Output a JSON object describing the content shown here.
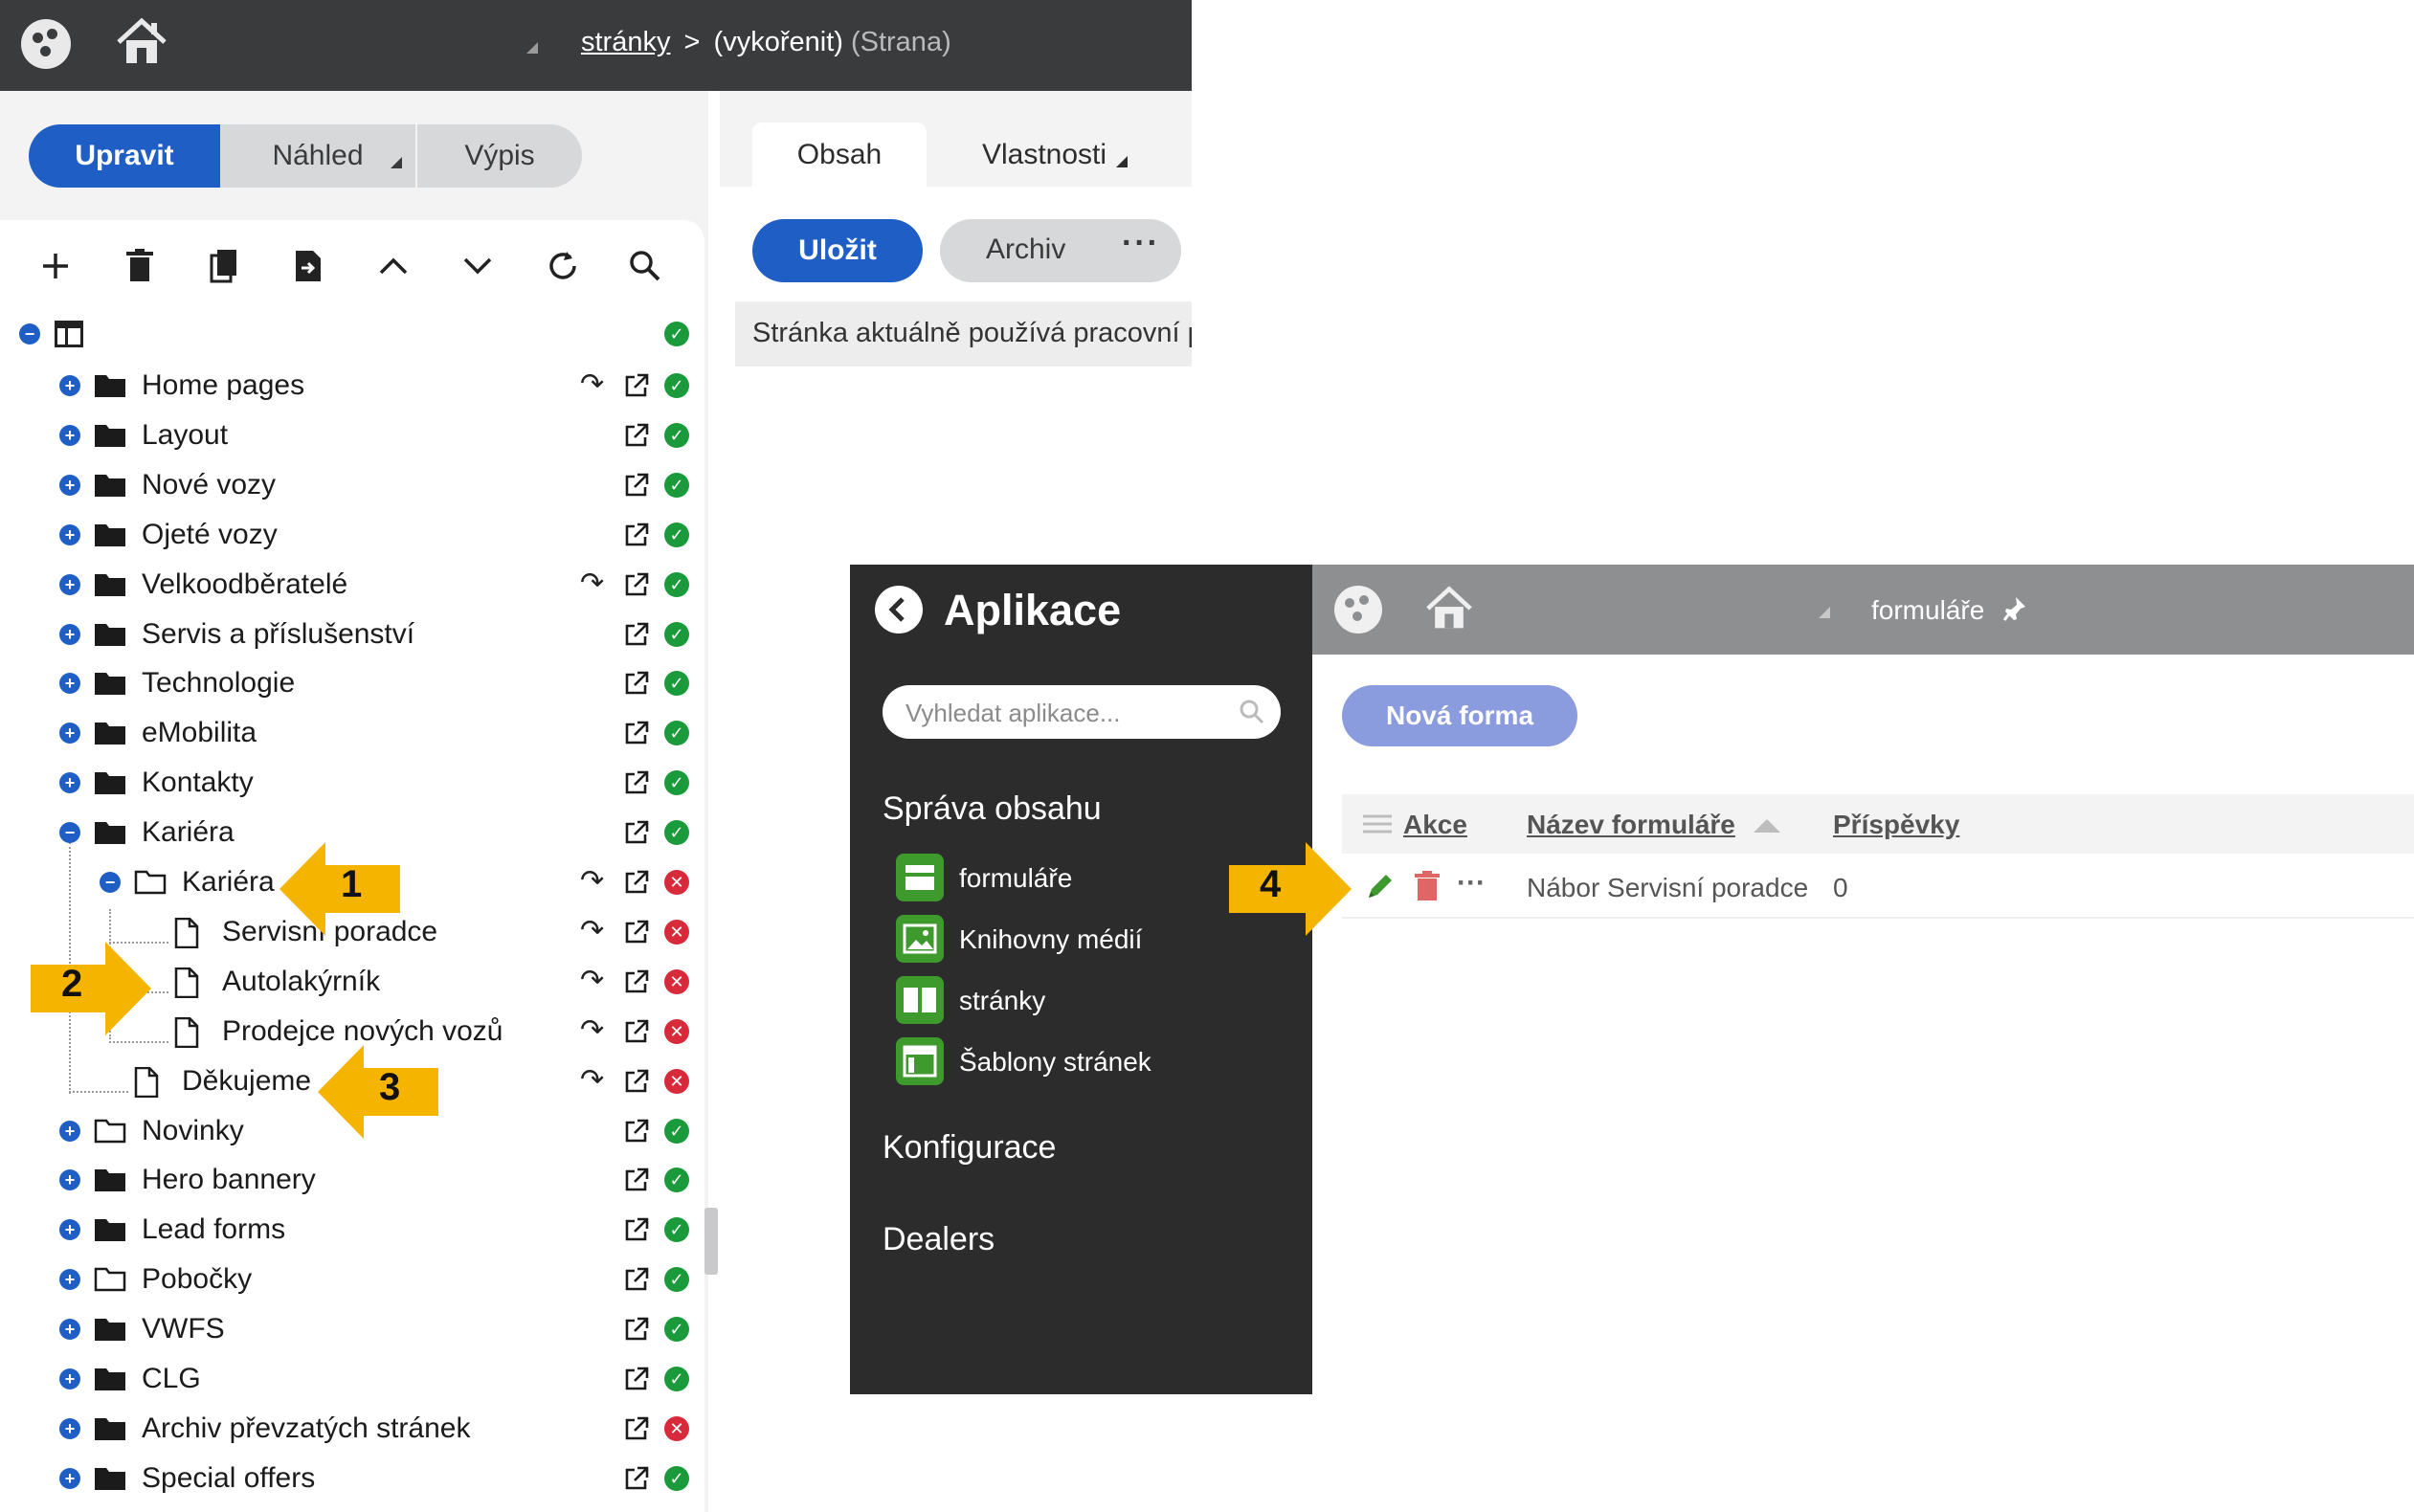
{
  "cms": {
    "breadcrumb": {
      "root": "stránky",
      "separator": ">",
      "current": "(vykořenit)",
      "suffix": "(Strana)"
    },
    "view_buttons": [
      "Upravit",
      "Náhled",
      "Výpis"
    ],
    "tabs": [
      "Obsah",
      "Vlastnosti"
    ],
    "save_label": "Uložit",
    "archive_label": "Archiv",
    "more_label": "···",
    "info_text": "Stránka aktuálně používá pracovní postup",
    "tree": [
      {
        "label": "Home pages"
      },
      {
        "label": "Layout"
      },
      {
        "label": "Nové vozy"
      },
      {
        "label": "Ojeté vozy"
      },
      {
        "label": "Velkoodběratelé"
      },
      {
        "label": "Servis a příslušenství"
      },
      {
        "label": "Technologie"
      },
      {
        "label": "eMobilita"
      },
      {
        "label": "Kontakty"
      },
      {
        "label": "Kariéra"
      },
      {
        "label": "Kariéra"
      },
      {
        "label": "Servisní poradce"
      },
      {
        "label": "Autolakýrník"
      },
      {
        "label": "Prodejce nových vozů"
      },
      {
        "label": "Děkujeme"
      },
      {
        "label": "Novinky"
      },
      {
        "label": "Hero bannery"
      },
      {
        "label": "Lead forms"
      },
      {
        "label": "Pobočky"
      },
      {
        "label": "VWFS"
      },
      {
        "label": "CLG"
      },
      {
        "label": "Archiv převzatých stránek"
      },
      {
        "label": "Special offers"
      }
    ]
  },
  "apps": {
    "title": "Aplikace",
    "search_placeholder": "Vyhledat aplikace...",
    "sections": [
      "Správa obsahu",
      "Konfigurace",
      "Dealers"
    ],
    "items": [
      "formuláře",
      "Knihovny médií",
      "stránky",
      "Šablony stránek"
    ],
    "accent_color": "#3f9a2e"
  },
  "forms": {
    "breadcrumb": "formuláře",
    "new_button": "Nová forma",
    "columns": [
      "Akce",
      "Název formuláře",
      "Příspěvky"
    ],
    "rows": [
      {
        "name": "Nábor Servisní poradce",
        "count": "0"
      }
    ]
  },
  "callouts": [
    "1",
    "2",
    "3",
    "4"
  ],
  "colors": {
    "primary": "#1f5fc5",
    "ok": "#1a9a3a",
    "error": "#d72a3a",
    "callout": "#f5b400"
  }
}
